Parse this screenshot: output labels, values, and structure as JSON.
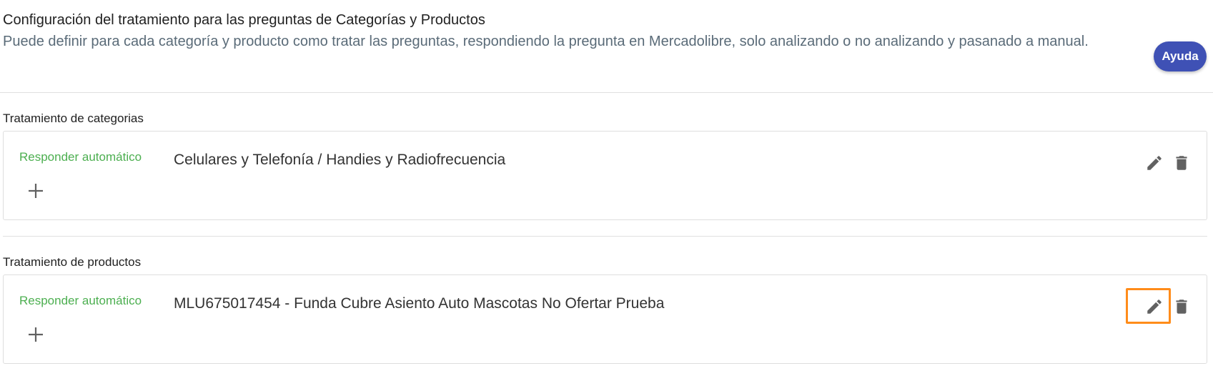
{
  "header": {
    "title": "Configuración del tratamiento para las preguntas de Categorías y Productos",
    "description": "Puede definir para cada categoría y producto como tratar las preguntas, respondiendo la pregunta en Mercadolibre, solo analizando o no analizando y pasanado a manual.",
    "help_label": "Ayuda"
  },
  "categories": {
    "label": "Tratamiento de categorias",
    "items": [
      {
        "mode": "Responder automático",
        "name": "Celulares y Telefonía / Handies y Radiofrecuencia",
        "add_icon": "plus-icon",
        "edit_icon": "pencil-icon",
        "delete_icon": "trash-icon"
      }
    ]
  },
  "products": {
    "label": "Tratamiento de productos",
    "items": [
      {
        "mode": "Responder automático",
        "name": "MLU675017454 - Funda Cubre Asiento Auto Mascotas No Ofertar Prueba",
        "add_icon": "plus-icon",
        "edit_icon": "pencil-icon",
        "delete_icon": "trash-icon"
      }
    ]
  },
  "colors": {
    "accent": "#3f51b5",
    "mode_text": "#4caf50",
    "highlight": "#ff8c1a",
    "icon": "#616161"
  }
}
